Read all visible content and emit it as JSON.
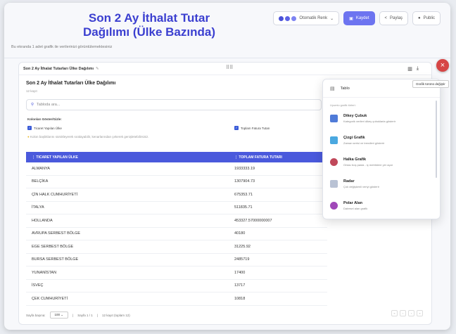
{
  "header": {
    "title_line1": "Son 2 Ay İthalat Tutar",
    "title_line2": "Dağılımı (Ülke Bazında)",
    "subtitle": "Bu ekranda 1 adet grafik ile verilerinizi görüntülemektesiniz",
    "color_label": "Otomatik Renk",
    "save_label": "Kaydet",
    "share_label": "Paylaş",
    "public_label": "Public"
  },
  "card": {
    "tab_label": "Son 2 Ay İthalat Tutarları Ülke Dağılımı",
    "title": "Son 2 Ay İthalat Tutarları Ülke Dağılımı",
    "count": "12 kayıt",
    "search_placeholder": "Tabloda ara...",
    "columns_label": "Kolonları Göster/Gizle:",
    "col1": "Ticaret Yapılan Ülke",
    "col2": "Toplam Fatura Tutarı",
    "hint": "Kolon başlıklarını sürükleyerek sıralayabilir, kenarlarından çekerek genişletebilirsiniz.",
    "tooltip": "Grafik türünü değiştir"
  },
  "table": {
    "headers": [
      "TICARET YAPILAN ÜLKE",
      "TOPLAM FATURA TUTARI"
    ],
    "rows": [
      [
        "ALMANYA",
        "1933333.19"
      ],
      [
        "BELÇİKA",
        "1307904.73"
      ],
      [
        "ÇİN HALK CUMHURİYETİ",
        "675353.71"
      ],
      [
        "İTALYA",
        "511835.71"
      ],
      [
        "HOLLANDA",
        "453327.57000000007"
      ],
      [
        "AVRUPA SERBEST BÖLGE",
        "40180"
      ],
      [
        "EGE SERBEST BÖLGE",
        "31225.92"
      ],
      [
        "BURSA SERBEST BÖLGE",
        "2485719"
      ],
      [
        "YUNANİSTAN",
        "17400"
      ],
      [
        "İSVEÇ",
        "13717"
      ],
      [
        "ÇEK CUMHURİYETİ",
        "10818"
      ]
    ]
  },
  "footer": {
    "page_size_label": "Sayfa başına:",
    "page_size": "100",
    "page_info": "Sayfa 1 / 1",
    "record_info": "12 kayıt (toplam 12)"
  },
  "dropdown": {
    "head": "Tablo",
    "note": "Uyumlu grafik türleri:",
    "items": [
      {
        "title": "Dikey Çubuk",
        "desc": "Kategorik verileri dikey çubuklarla gösterir",
        "icon": "bar-chart-icon",
        "color": "#4f7bd8"
      },
      {
        "title": "Çizgi Grafik",
        "desc": "Zaman serisi ve trendleri gösterir",
        "icon": "line-chart-icon",
        "color": "#4aa8e0"
      },
      {
        "title": "Halka Grafik",
        "desc": "Ortası boş pasta - iç metriklere yer açar",
        "icon": "donut-chart-icon",
        "color": "#c0485a"
      },
      {
        "title": "Radar",
        "desc": "Çok değişkenli veriyi gösterir",
        "icon": "radar-chart-icon",
        "color": "#b9c2d4"
      },
      {
        "title": "Polar Alan",
        "desc": "Dairesel alan grafik",
        "icon": "polar-chart-icon",
        "color": "#a048b8"
      }
    ]
  }
}
